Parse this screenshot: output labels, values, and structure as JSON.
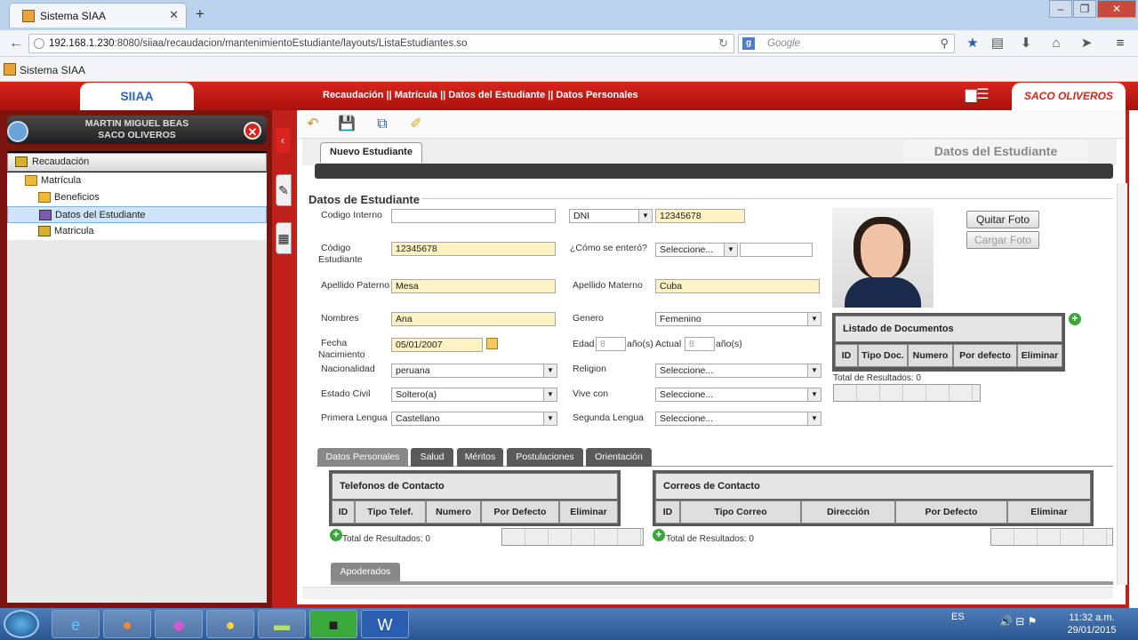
{
  "browser": {
    "tab_title": "Sistema SIAA",
    "url_host": "192.168.1.230",
    "url_rest": ":8080/siiaa/recaudacion/mantenimientoEstudiante/layouts/ListaEstudiantes.so",
    "search_placeholder": "Google",
    "bookmark": "Sistema SIAA"
  },
  "header": {
    "app_name": "SIIAA",
    "breadcrumb": "Recaudación || Matrícula || Datos del Estudiante || Datos Personales",
    "logo": "SACO OLIVEROS"
  },
  "user": {
    "name": "MARTIN MIGUEL BEAS",
    "org": "SACO OLIVEROS"
  },
  "tree": {
    "root": "Recaudación",
    "folder": "Matrícula",
    "items": [
      "Beneficios",
      "Datos del Estudiante",
      "Matricula"
    ]
  },
  "form": {
    "tab": "Nuevo Estudiante",
    "title": "Datos del Estudiante",
    "legend": "Datos de Estudiante",
    "labels": {
      "codigo_interno": "Codigo Interno",
      "codigo_estudiante_1": "Código",
      "codigo_estudiante_2": "Estudiante",
      "como_se_entero": "¿Cómo se enteró?",
      "apellido_paterno": "Apellido Paterno",
      "apellido_materno": "Apellido Materno",
      "nombres": "Nombres",
      "genero": "Genero",
      "fecha_1": "Fecha",
      "fecha_2": "Nacimiento",
      "edad": "Edad",
      "anios": "año(s)",
      "actual": "Actual",
      "nacionalidad": "Nacionalidad",
      "religion": "Religion",
      "estado_civil": "Estado Civil",
      "vive_con": "Vive con",
      "primera_lengua": "Primera Lengua",
      "segunda_lengua": "Segunda Lengua"
    },
    "values": {
      "codigo_interno": "",
      "doc_tipo": "DNI",
      "doc_numero": "12345678",
      "codigo_estudiante": "12345678",
      "como_se_entero": "Seleccione...",
      "como_se_entero_extra": "",
      "apellido_paterno": "Mesa",
      "apellido_materno": "Cuba",
      "nombres": "Ana",
      "genero": "Femenino",
      "fecha_nacimiento": "05/01/2007",
      "edad": "8",
      "actual": "8",
      "nacionalidad": "peruana",
      "religion": "Seleccione...",
      "estado_civil": "Soltero(a)",
      "vive_con": "Seleccione...",
      "primera_lengua": "Castellano",
      "segunda_lengua": "Seleccione..."
    },
    "buttons": {
      "quitar_foto": "Quitar Foto",
      "cargar_foto": "Cargar Foto"
    }
  },
  "documents": {
    "title": "Listado de Documentos",
    "columns": [
      "ID",
      "Tipo Doc.",
      "Numero",
      "Por defecto",
      "Eliminar"
    ],
    "total": "Total de Resultados: 0"
  },
  "subtabs": [
    "Datos Personales",
    "Salud",
    "Méritos",
    "Postulaciones",
    "Orientación"
  ],
  "phones": {
    "title": "Telefonos de Contacto",
    "columns": [
      "ID",
      "Tipo Telef.",
      "Numero",
      "Por Defecto",
      "Eliminar"
    ],
    "total": "Total de Resultados: 0"
  },
  "emails": {
    "title": "Correos de Contacto",
    "columns": [
      "ID",
      "Tipo Correo",
      "Dirección",
      "Por Defecto",
      "Eliminar"
    ],
    "total": "Total de Resultados: 0"
  },
  "apoderados_tab": "Apoderados",
  "taskbar": {
    "lang": "ES",
    "time": "11:32 a.m.",
    "date": "29/01/2015"
  }
}
